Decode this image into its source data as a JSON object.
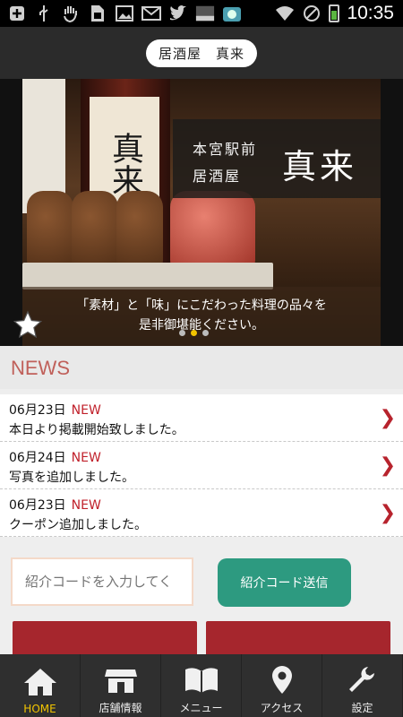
{
  "status_bar": {
    "left_icons": [
      "plus-icon",
      "usb-icon",
      "hand-icon",
      "sim-icon",
      "image-icon",
      "mail-icon",
      "twitter-icon",
      "card-icon",
      "camera-icon"
    ],
    "right_icons": [
      "wifi-icon",
      "no-signal-icon",
      "battery-charging-icon"
    ],
    "time": "10:35"
  },
  "header": {
    "title": "居酒屋　真来"
  },
  "hero": {
    "bottle_label": "真来",
    "panel_line1": "本宮駅前",
    "panel_line2": "居酒屋",
    "panel_name": "真来",
    "caption_line1": "「素材」と「味」にこだわった料理の品々を",
    "caption_line2": "是非御堪能ください。",
    "slides_total": 3,
    "slide_active": 1
  },
  "news": {
    "heading": "NEWS",
    "items": [
      {
        "date": "06月23日",
        "badge": "NEW",
        "text": "本日より掲載開始致しました。"
      },
      {
        "date": "06月24日",
        "badge": "NEW",
        "text": "写真を追加しました。"
      },
      {
        "date": "06月23日",
        "badge": "NEW",
        "text": "クーポン追加しました。"
      }
    ]
  },
  "referral": {
    "placeholder": "紹介コードを入力してく",
    "submit_label": "紹介コード送信"
  },
  "tabs": [
    {
      "label": "HOME",
      "icon": "home-icon",
      "active": true
    },
    {
      "label": "店舗情報",
      "icon": "shop-icon",
      "active": false
    },
    {
      "label": "メニュー",
      "icon": "menu-book-icon",
      "active": false
    },
    {
      "label": "アクセス",
      "icon": "map-pin-icon",
      "active": false
    },
    {
      "label": "設定",
      "icon": "wrench-icon",
      "active": false
    }
  ],
  "colors": {
    "accent_red": "#b7232d",
    "news_heading": "#c0605a",
    "button_green": "#2d9a80",
    "tab_active": "#f2c400"
  }
}
